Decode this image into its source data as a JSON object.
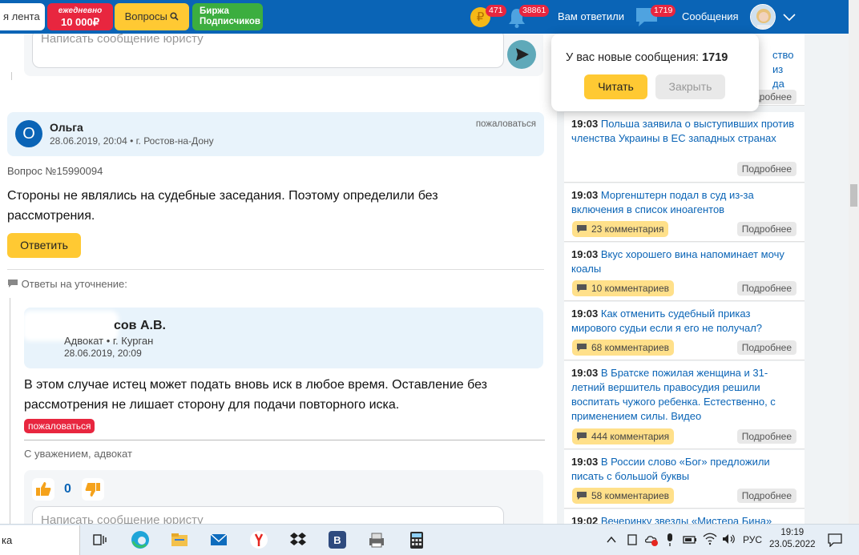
{
  "topbar": {
    "lenta": "я лента",
    "promo_line1": "ежедневно",
    "promo_line2": "10 000₽",
    "questions": "Вопросы",
    "birzha_line1": "Биржа",
    "birzha_line2": "Подписчиков",
    "coin_symbol": "₽",
    "coin_badge": "471",
    "bell_badge": "38861",
    "answered_label": "Вам ответили",
    "chat_badge": "1719",
    "messages_label": "Сообщения"
  },
  "main": {
    "message_placeholder": "Написать сообщение юристу",
    "question": {
      "author_initial": "О",
      "author_name": "Ольга",
      "meta": "28.06.2019, 20:04 • г. Ростов-на-Дону",
      "report": "пожаловаться",
      "number": "Вопрос №15990094",
      "text": "Стороны не являлись на судебные заседания. Поэтому определили без рассмотрения.",
      "answer_button": "Ответить"
    },
    "clarifications_label": "Ответы на уточнение:",
    "answer": {
      "lawyer_name": "сов А.В.",
      "role": "Адвокат • г. Курган",
      "date": "28.06.2019, 20:09",
      "text": "В этом случае истец может подать вновь иск в любое время. Оставление без рассмотрения не лишает сторону для подачи повторного иска.",
      "report": "пожаловаться",
      "regards": "С уважением, адвокат",
      "vote_count": "0"
    }
  },
  "popup": {
    "text": "У вас новые сообщения:",
    "count": "1719",
    "read_button": "Читать",
    "close_button": "Закрыть"
  },
  "sidebar": {
    "top_fragment": [
      " ",
      "ство из",
      "да есть"
    ],
    "more_label": "Подробнее",
    "news": [
      {
        "time": "19:03",
        "title": "Польша заявила о выступивших против членства Украины в ЕС западных странах",
        "comments": ""
      },
      {
        "time": "19:03",
        "title": "Моргенштерн подал в суд из-за включения в список иноагентов",
        "comments": "23 комментария"
      },
      {
        "time": "19:03",
        "title": "Вкус хорошего вина напоминает мочу коалы",
        "comments": "10 комментариев"
      },
      {
        "time": "19:03",
        "title": "Как отменить судебный приказ мирового судьи если я его не получал?",
        "comments": "68 комментариев"
      },
      {
        "time": "19:03",
        "title": "В Братске пожилая женщина и 31-летний вершитель правосудия решили воспитать чужого ребенка. Естественно, с применением силы. Видео",
        "comments": "444 комментария"
      },
      {
        "time": "19:03",
        "title": "В России слово «Бог» предложили писать с большой буквы",
        "comments": "58 комментариев"
      },
      {
        "time": "19:02",
        "title": "Вечеринку звезды «Мистера Бина»",
        "comments": ""
      }
    ]
  },
  "taskbar": {
    "search_text": "ка",
    "lang": "РУС",
    "time": "19:19",
    "date": "23.05.2022"
  }
}
